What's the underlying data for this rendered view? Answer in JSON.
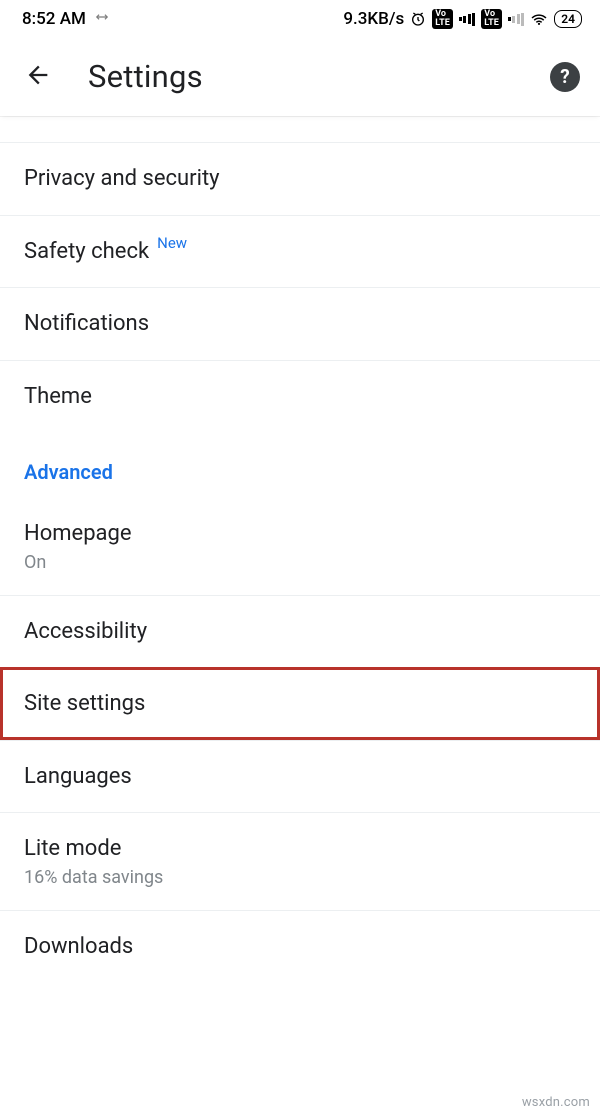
{
  "status": {
    "time": "8:52 AM",
    "data_rate": "9.3KB/s",
    "volte": "Vo LTE",
    "battery": "24"
  },
  "appbar": {
    "title": "Settings"
  },
  "rows": {
    "privacy": {
      "label": "Privacy and security"
    },
    "safety": {
      "label": "Safety check",
      "badge": "New"
    },
    "notifications": {
      "label": "Notifications"
    },
    "theme": {
      "label": "Theme"
    },
    "section_advanced": {
      "label": "Advanced"
    },
    "homepage": {
      "label": "Homepage",
      "sub": "On"
    },
    "accessibility": {
      "label": "Accessibility"
    },
    "site_settings": {
      "label": "Site settings"
    },
    "languages": {
      "label": "Languages"
    },
    "lite_mode": {
      "label": "Lite mode",
      "sub": "16% data savings"
    },
    "downloads": {
      "label": "Downloads"
    }
  },
  "watermark": "wsxdn.com"
}
